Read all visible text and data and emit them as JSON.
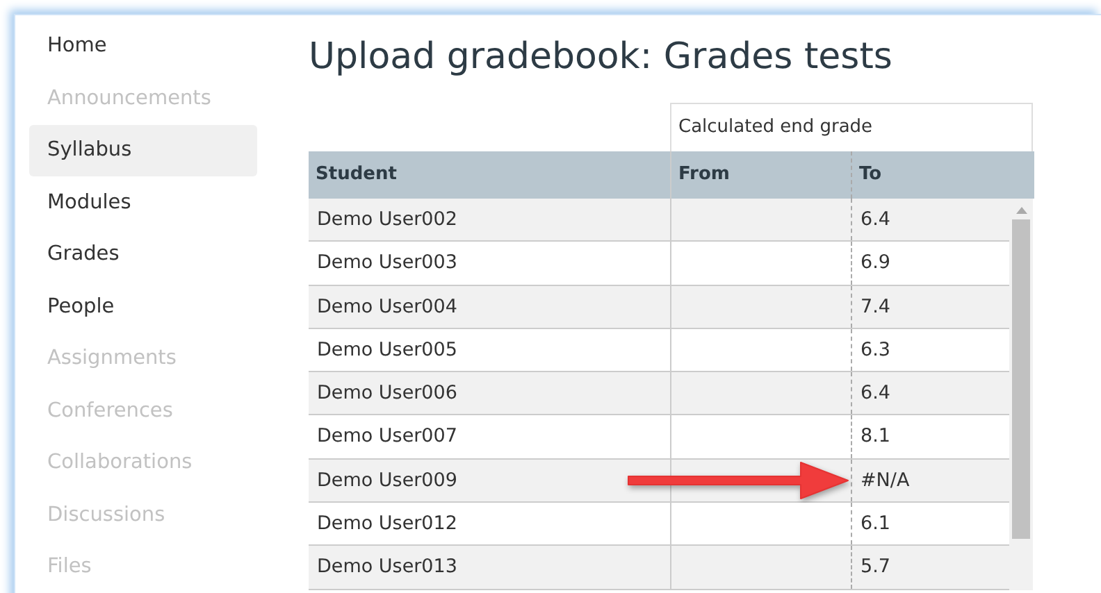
{
  "sidebar": {
    "items": [
      {
        "label": "Home",
        "selected": false,
        "disabled": false
      },
      {
        "label": "Announcements",
        "selected": false,
        "disabled": true
      },
      {
        "label": "Syllabus",
        "selected": true,
        "disabled": false
      },
      {
        "label": "Modules",
        "selected": false,
        "disabled": false
      },
      {
        "label": "Grades",
        "selected": false,
        "disabled": false
      },
      {
        "label": "People",
        "selected": false,
        "disabled": false
      },
      {
        "label": "Assignments",
        "selected": false,
        "disabled": true
      },
      {
        "label": "Conferences",
        "selected": false,
        "disabled": true
      },
      {
        "label": "Collaborations",
        "selected": false,
        "disabled": true
      },
      {
        "label": "Discussions",
        "selected": false,
        "disabled": true
      },
      {
        "label": "Files",
        "selected": false,
        "disabled": true
      }
    ]
  },
  "page_title": "Upload gradebook: Grades tests",
  "table": {
    "group_header": "Calculated end grade",
    "columns": [
      "Student",
      "From",
      "To"
    ],
    "rows": [
      {
        "student": "Demo User002",
        "to": "6.4",
        "annotated": false
      },
      {
        "student": "Demo User003",
        "to": "6.9",
        "annotated": false
      },
      {
        "student": "Demo User004",
        "to": "7.4",
        "annotated": false
      },
      {
        "student": "Demo User005",
        "to": "6.3",
        "annotated": false
      },
      {
        "student": "Demo User006",
        "to": "6.4",
        "annotated": false
      },
      {
        "student": "Demo User007",
        "to": "8.1",
        "annotated": false
      },
      {
        "student": "Demo User009",
        "to": "#N/A",
        "annotated": true
      },
      {
        "student": "Demo User012",
        "to": "6.1",
        "annotated": false
      },
      {
        "student": "Demo User013",
        "to": "5.7",
        "annotated": false
      }
    ]
  }
}
